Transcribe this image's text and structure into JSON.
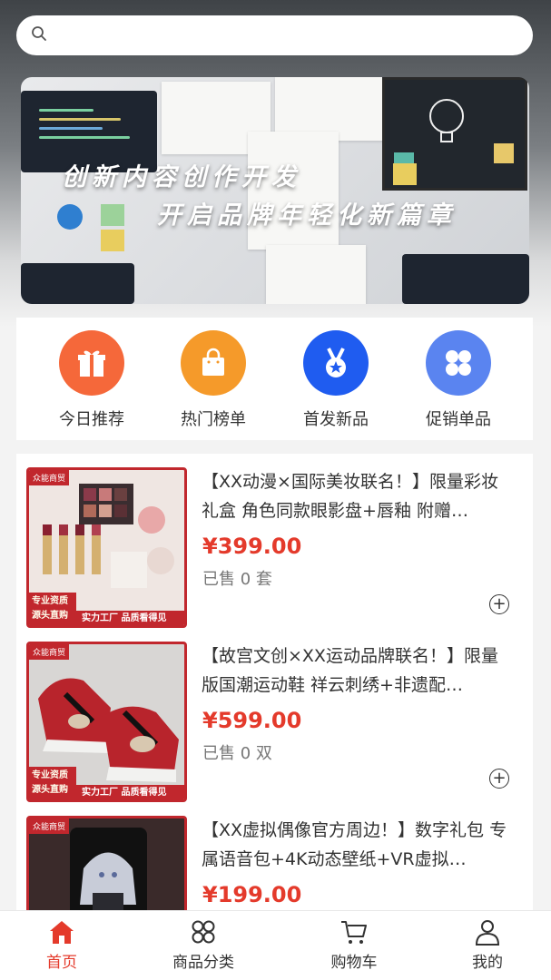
{
  "search": {
    "placeholder": ""
  },
  "banner": {
    "line1": "创新内容创作开发",
    "line2": "开启品牌年轻化新篇章"
  },
  "quick_entries": [
    {
      "label": "今日推荐",
      "icon": "gift-icon",
      "color": "#f5683a"
    },
    {
      "label": "热门榜单",
      "icon": "shopping-bag-icon",
      "color": "#f59a2a"
    },
    {
      "label": "首发新品",
      "icon": "medal-icon",
      "color": "#1f5cf0"
    },
    {
      "label": "促销单品",
      "icon": "grid-icon",
      "color": "#5a84f0"
    }
  ],
  "products": [
    {
      "title": "【XX动漫×国际美妆联名！】限量彩妆礼盒 角色同款眼影盘+唇釉 附赠…",
      "price": "¥399.00",
      "sold": "已售 0 套",
      "tag": "众能商贸",
      "badge": "专业资质 源头直购",
      "strip": "实力工厂 品质看得见"
    },
    {
      "title": "【故宫文创×XX运动品牌联名！】限量版国潮运动鞋 祥云刺绣+非遗配…",
      "price": "¥599.00",
      "sold": "已售 0 双",
      "tag": "众能商贸",
      "badge": "专业资质 源头直购",
      "strip": "实力工厂 品质看得见"
    },
    {
      "title": "【XX虚拟偶像官方周边！】数字礼包 专属语音包+4K动态壁纸+VR虚拟…",
      "price": "¥199.00",
      "sold": "",
      "tag": "众能商贸",
      "badge": "",
      "strip": ""
    }
  ],
  "tabs": [
    {
      "label": "首页",
      "icon": "home-icon",
      "active": true
    },
    {
      "label": "商品分类",
      "icon": "category-icon",
      "active": false
    },
    {
      "label": "购物车",
      "icon": "cart-icon",
      "active": false
    },
    {
      "label": "我的",
      "icon": "user-icon",
      "active": false
    }
  ],
  "colors": {
    "accent": "#e43a2b",
    "brand_red": "#c1272d"
  }
}
